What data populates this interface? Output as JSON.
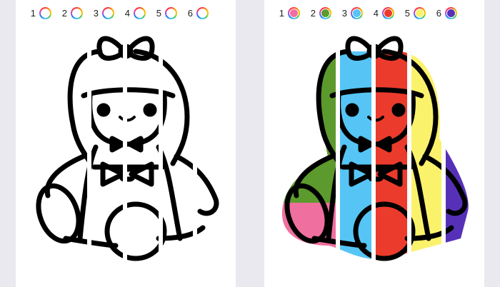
{
  "left_panel": {
    "palette": [
      {
        "num": "1",
        "color": ""
      },
      {
        "num": "2",
        "color": ""
      },
      {
        "num": "3",
        "color": ""
      },
      {
        "num": "4",
        "color": ""
      },
      {
        "num": "5",
        "color": ""
      },
      {
        "num": "6",
        "color": ""
      }
    ]
  },
  "right_panel": {
    "palette": [
      {
        "num": "1",
        "color": "#ef6f9e"
      },
      {
        "num": "2",
        "color": "#5c9a2e"
      },
      {
        "num": "3",
        "color": "#56c5f6"
      },
      {
        "num": "4",
        "color": "#eb3b2c"
      },
      {
        "num": "5",
        "color": "#fbf26c"
      },
      {
        "num": "6",
        "color": "#5631b8"
      }
    ]
  },
  "colors": {
    "outline": "#000000",
    "background": "#e9e9ef",
    "panel": "#ffffff"
  }
}
